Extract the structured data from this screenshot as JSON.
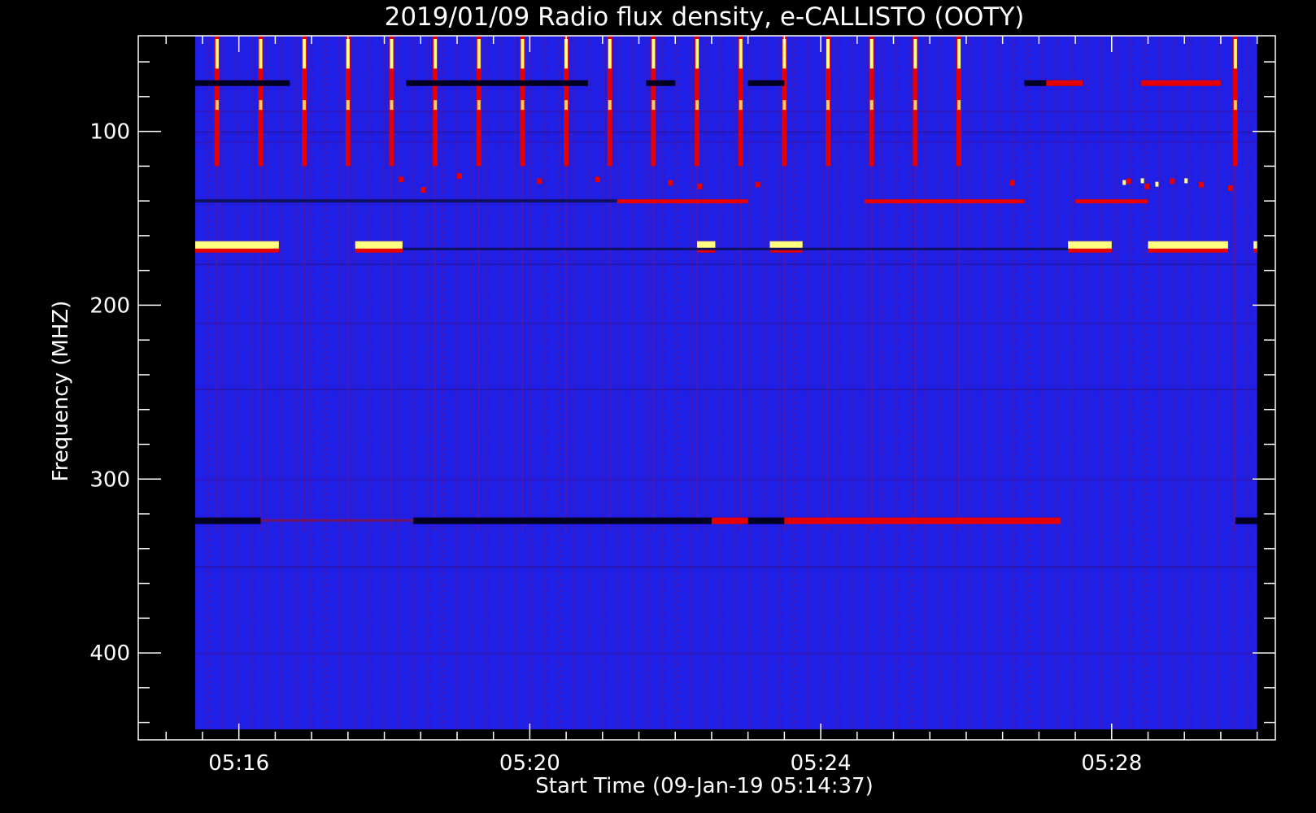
{
  "chart_data": {
    "type": "heatmap",
    "title": "2019/01/09  Radio flux density, e-CALLISTO (OOTY)",
    "xlabel": "Start Time (09-Jan-19 05:14:37)",
    "ylabel": "Frequency (MHZ)",
    "x_ticks": [
      "05:16",
      "05:20",
      "05:24",
      "05:28"
    ],
    "x_tick_minutes": [
      16,
      20,
      24,
      28
    ],
    "y_ticks": [
      "100",
      "200",
      "300",
      "400"
    ],
    "y_tick_values": [
      100,
      200,
      300,
      400
    ],
    "xlim_minutes": [
      14.617,
      30.25
    ],
    "data_x_minutes": [
      15.4,
      30.0
    ],
    "ylim_mhz": [
      45,
      450
    ],
    "data_y_mhz": [
      45,
      444
    ],
    "y_reversed": true,
    "grid": false,
    "colors": {
      "background": "#000000",
      "base": "#1f1fe6",
      "base_dark": "#1414b0",
      "emission": "#e60000",
      "strong": "#ffff80",
      "absorption": "#000020"
    },
    "features": {
      "vertical_bursts_minutes": [
        15.7,
        16.3,
        16.9,
        17.5,
        18.1,
        18.7,
        19.3,
        19.9,
        20.5,
        21.1,
        21.7,
        22.3,
        22.9,
        23.5,
        24.1,
        24.7,
        25.3,
        25.9,
        29.7
      ],
      "vertical_burst_mhz": [
        45,
        120
      ],
      "band_bright_mhz": 166,
      "band_bright_segments": [
        [
          15.4,
          16.55
        ],
        [
          17.6,
          18.25
        ],
        [
          22.3,
          22.55
        ],
        [
          23.3,
          23.75
        ],
        [
          27.4,
          28.0
        ],
        [
          28.5,
          29.6
        ],
        [
          29.95,
          30.0
        ]
      ],
      "band_dark_mhz": 72,
      "band_dark_segments": [
        [
          15.4,
          16.7
        ],
        [
          18.3,
          20.8
        ],
        [
          21.6,
          22.0
        ],
        [
          23.0,
          23.5
        ],
        [
          26.8,
          27.6
        ]
      ],
      "band_red_mhz": 140,
      "band_red_segments": [
        [
          21.2,
          23.0
        ],
        [
          24.6,
          26.8
        ],
        [
          27.5,
          28.5
        ]
      ],
      "band_low_mhz": 324,
      "band_low_dark_segments": [
        [
          15.4,
          16.3
        ],
        [
          18.4,
          22.5
        ],
        [
          22.9,
          23.5
        ],
        [
          29.7,
          30.0
        ]
      ],
      "band_low_red_segments": [
        [
          22.5,
          23.0
        ],
        [
          23.5,
          27.3
        ]
      ]
    }
  }
}
